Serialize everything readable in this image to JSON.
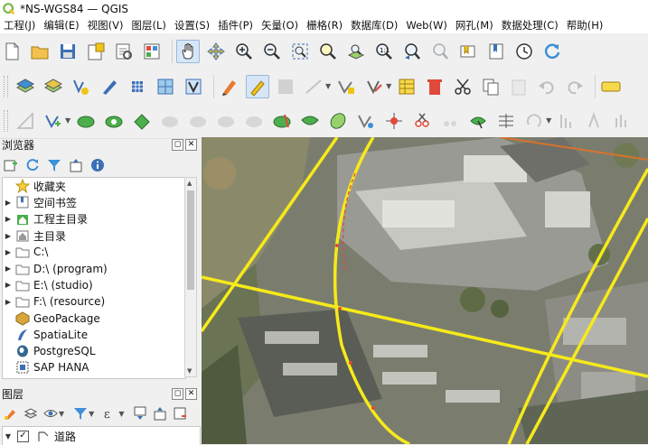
{
  "window": {
    "title": "*NS-WGS84 — QGIS"
  },
  "menu": [
    "工程(J)",
    "编辑(E)",
    "视图(V)",
    "图层(L)",
    "设置(S)",
    "插件(P)",
    "矢量(O)",
    "栅格(R)",
    "数据库(D)",
    "Web(W)",
    "网孔(M)",
    "数据处理(C)",
    "帮助(H)"
  ],
  "toolbar1_icons": [
    "new-project",
    "open-project",
    "save-project",
    "new-print-layout",
    "layout-manager",
    "style-manager",
    "pan",
    "pan-to-selection",
    "zoom-in",
    "zoom-out",
    "zoom-full",
    "zoom-to-selection",
    "zoom-to-layer",
    "zoom-to-native",
    "zoom-last",
    "zoom-next",
    "new-spatial-bookmark",
    "show-bookmarks",
    "refresh",
    "temporal-controller",
    "reload"
  ],
  "browser": {
    "title": "浏览器",
    "items": [
      {
        "label": "收藏夹",
        "icon": "star-icon",
        "expand": true
      },
      {
        "label": "空间书签",
        "icon": "bookmark-icon",
        "expand": true
      },
      {
        "label": "工程主目录",
        "icon": "home-folder-icon",
        "expand": true
      },
      {
        "label": "主目录",
        "icon": "home-icon",
        "expand": true
      },
      {
        "label": "C:\\",
        "icon": "drive-icon",
        "expand": true
      },
      {
        "label": "D:\\ (program)",
        "icon": "drive-icon",
        "expand": true
      },
      {
        "label": "E:\\ (studio)",
        "icon": "drive-icon",
        "expand": true
      },
      {
        "label": "F:\\ (resource)",
        "icon": "drive-icon",
        "expand": true
      },
      {
        "label": "GeoPackage",
        "icon": "geopackage-icon",
        "expand": false
      },
      {
        "label": "SpatiaLite",
        "icon": "spatialite-icon",
        "expand": false
      },
      {
        "label": "PostgreSQL",
        "icon": "postgresql-icon",
        "expand": false
      },
      {
        "label": "SAP HANA",
        "icon": "sap-hana-icon",
        "expand": false
      }
    ]
  },
  "layers": {
    "title": "图层",
    "items": [
      {
        "label": "道路",
        "checked": true
      }
    ]
  },
  "colors": {
    "accent": "#f3e217",
    "selection": "#d6e6f7",
    "road": "#f6ea1a",
    "boundary": "#d9722b"
  }
}
